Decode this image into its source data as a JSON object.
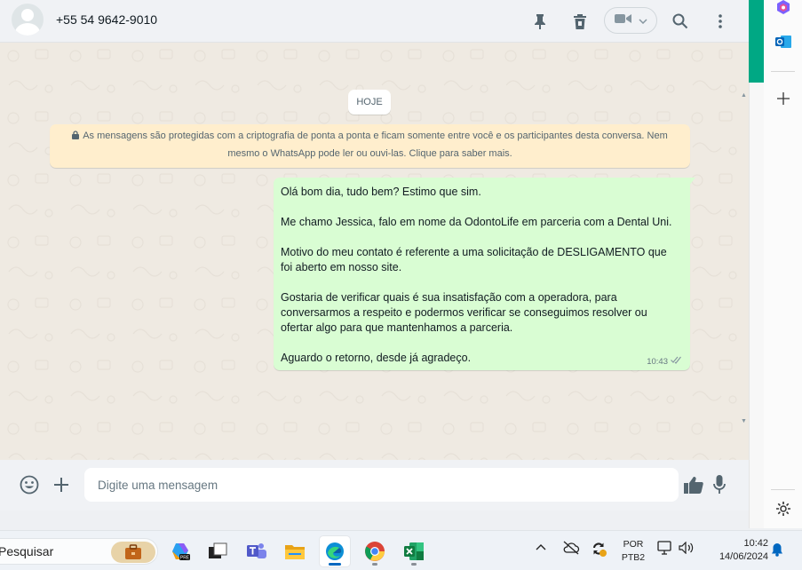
{
  "header": {
    "contact_name": "+55 54 9642-9010",
    "icons": [
      "pin-icon",
      "delete-icon",
      "video-call-icon",
      "chevron-down-icon",
      "search-icon",
      "more-vertical-icon"
    ]
  },
  "chat": {
    "date_chip": "HOJE",
    "encryption_notice_line1": "As mensagens são protegidas com a criptografia de ponta a ponta e ficam somente entre você e os participantes desta conversa. Nem",
    "encryption_notice_line2": "mesmo o WhatsApp pode ler ou ouvi-las. Clique para saber mais.",
    "message": {
      "lines": [
        "Olá bom dia, tudo bem? Estimo que sim.",
        "",
        "Me chamo Jessica, falo em nome da OdontoLife em parceria com a Dental Uni.",
        "",
        "Motivo do meu contato é referente a uma solicitação de DESLIGAMENTO que",
        "foi aberto em nosso site.",
        "",
        "Gostaria de verificar quais é sua insatisfação com a operadora, para",
        "conversarmos a respeito e podermos verificar se conseguimos resolver ou",
        "ofertar algo para que mantenhamos a parceria.",
        "",
        "Aguardo o retorno, desde já agradeço."
      ],
      "time": "10:43",
      "status": "read"
    }
  },
  "composer": {
    "placeholder": "Digite uma mensagem",
    "icons": [
      "emoji-icon",
      "plus-icon",
      "thumbs-up-icon",
      "microphone-icon"
    ]
  },
  "taskbar": {
    "search_text": "Pesquisar",
    "apps": [
      "copilot",
      "task-view",
      "teams",
      "file-explorer",
      "edge",
      "chrome",
      "excel"
    ],
    "language_line1": "POR",
    "language_line2": "PTB2",
    "time": "10:42",
    "date": "14/06/2024"
  },
  "colors": {
    "bubble_out": "#d9fdd3",
    "notice_bg": "#ffeecd",
    "accent_green": "#00a884",
    "chat_bg": "#efeae2"
  }
}
